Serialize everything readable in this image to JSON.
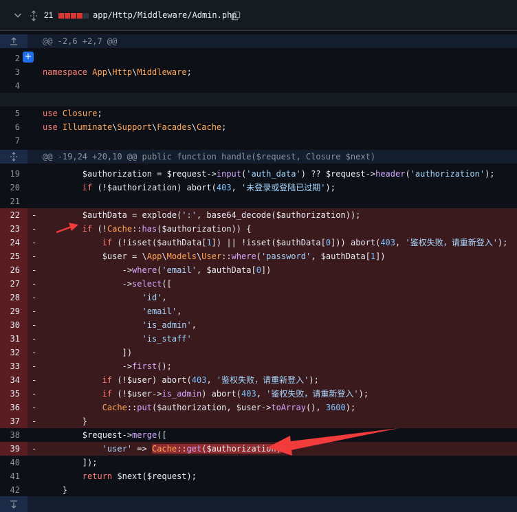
{
  "header": {
    "changes_count": "21",
    "file_path": "app/Http/Middleware/Admin.php",
    "diffstat_colors": [
      "#da3633",
      "#da3633",
      "#da3633",
      "#da3633",
      "#30363d"
    ],
    "icons": [
      "chevron-down-icon",
      "unfold-icon",
      "copy-icon"
    ]
  },
  "hunks": {
    "first": "@@ -2,6 +2,7 @@",
    "second": "@@ -19,24 +20,10 @@ public function handle($request, Closure $next)"
  },
  "line_numbers": {
    "l2": "2",
    "l3": "3",
    "l4": "4",
    "l5": "5",
    "l6": "6",
    "l7": "7",
    "l19": "19",
    "l20": "20",
    "l21": "21",
    "l22": "22",
    "l23": "23",
    "l24": "24",
    "l25": "25",
    "l26": "26",
    "l27": "27",
    "l28": "28",
    "l29": "29",
    "l30": "30",
    "l31": "31",
    "l32": "32",
    "l33": "33",
    "l34": "34",
    "l35": "35",
    "l36": "36",
    "l37": "37",
    "l38": "38",
    "l39": "39",
    "l40": "40",
    "l41": "41",
    "l42": "42"
  },
  "deletion_marker": "-",
  "add_comment_label": "+",
  "colors": {
    "background": "#0d1117",
    "deleted_line": "#3b1a1d",
    "deleted_gutter": "#5a1e22",
    "hunk_header": "#131d2e",
    "annotation_arrow": "#f23b3b",
    "add_button": "#1f6feb"
  }
}
